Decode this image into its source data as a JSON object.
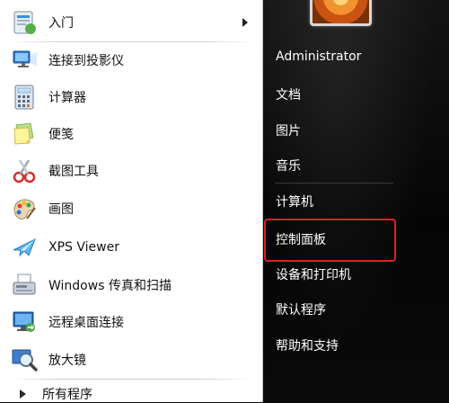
{
  "programs": [
    {
      "label": "入门",
      "icon": "getting-started-icon",
      "has_submenu": true
    },
    {
      "label": "连接到投影仪",
      "icon": "projector-icon"
    },
    {
      "label": "计算器",
      "icon": "calculator-icon"
    },
    {
      "label": "便笺",
      "icon": "sticky-notes-icon"
    },
    {
      "label": "截图工具",
      "icon": "snipping-tool-icon"
    },
    {
      "label": "画图",
      "icon": "paint-icon"
    },
    {
      "label": "XPS Viewer",
      "icon": "xps-viewer-icon"
    },
    {
      "label": "Windows 传真和扫描",
      "icon": "fax-scan-icon"
    },
    {
      "label": "远程桌面连接",
      "icon": "remote-desktop-icon"
    },
    {
      "label": "放大镜",
      "icon": "magnifier-icon"
    }
  ],
  "all_programs_label": "所有程序",
  "right": {
    "username": "Administrator",
    "documents": "文档",
    "pictures": "图片",
    "music": "音乐",
    "computer": "计算机",
    "control_panel": "控制面板",
    "devices_printers": "设备和打印机",
    "default_programs": "默认程序",
    "help_support": "帮助和支持"
  },
  "colors": {
    "highlight_border": "#e02020",
    "left_panel_bg": "#ffffff",
    "right_pane_bg": "#0b0b0b"
  }
}
